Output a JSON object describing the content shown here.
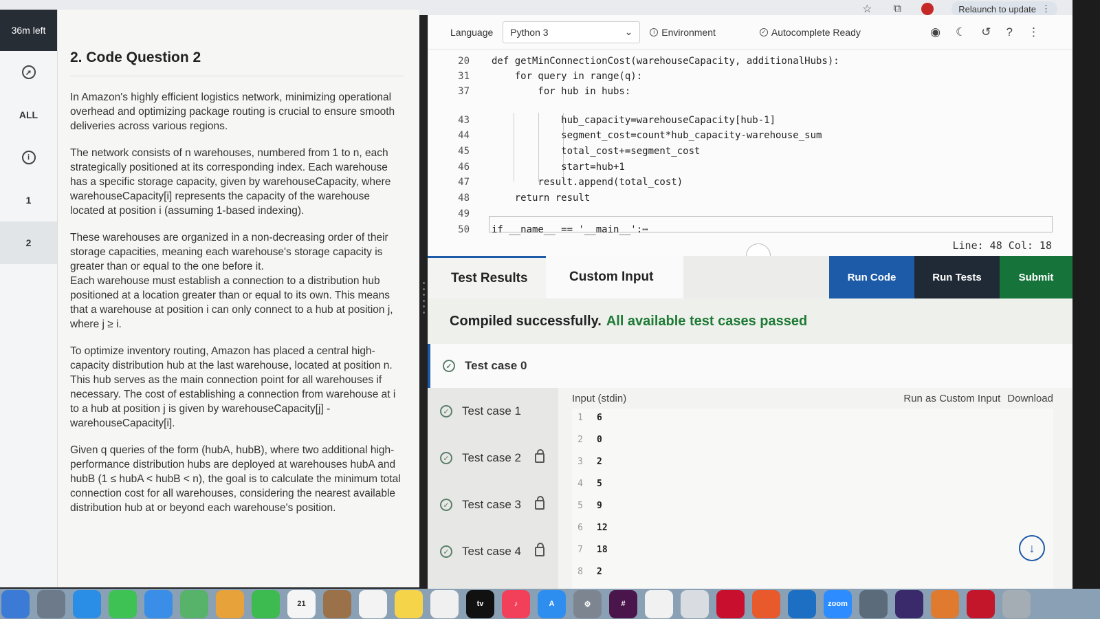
{
  "browser": {
    "relaunch_label": "Relaunch to update"
  },
  "left_nav": {
    "timer": "36m left",
    "items": [
      "ALL",
      "1",
      "2"
    ]
  },
  "problem": {
    "title": "2. Code Question 2",
    "p1": "In Amazon's highly efficient logistics network, minimizing operational overhead and optimizing package routing is crucial to ensure smooth deliveries across various regions.",
    "p2": "The network consists of n warehouses, numbered from 1 to n, each strategically positioned at its corresponding index. Each warehouse has a specific storage capacity, given by warehouseCapacity, where warehouseCapacity[i] represents the capacity of the warehouse located at position i (assuming 1-based indexing).",
    "p3": "These warehouses are organized in a non-decreasing order of their storage capacities, meaning each warehouse's storage capacity is greater than or equal to the one before it.",
    "p4": "Each warehouse must establish a connection to a distribution hub positioned at a location greater than or equal to its own. This means that a warehouse at position i can only connect to a hub at position j, where j ≥ i.",
    "p5": "To optimize inventory routing, Amazon has placed a central high-capacity distribution hub at the last warehouse, located at position n. This hub serves as the main connection point for all warehouses if necessary. The cost of establishing a connection from warehouse at i to a hub at position j is given by warehouseCapacity[j] - warehouseCapacity[i].",
    "p6": "Given q queries of the form (hubA, hubB), where two additional high-performance distribution hubs are deployed at warehouses hubA and hubB (1 ≤ hubA < hubB < n), the goal is to calculate the minimum total connection cost for all warehouses, considering the nearest available distribution hub at or beyond each warehouse's position."
  },
  "editor": {
    "language_label": "Language",
    "language_value": "Python 3",
    "environment_label": "Environment",
    "autocomplete_label": "Autocomplete Ready",
    "status": "Line: 48 Col: 18",
    "lines": [
      {
        "n": "20",
        "code": "def getMinConnectionCost(warehouseCapacity, additionalHubs):"
      },
      {
        "n": "31",
        "code": "    for query in range(q):"
      },
      {
        "n": "37",
        "code": "        for hub in hubs:"
      },
      {
        "n": "43",
        "code": "            hub_capacity=warehouseCapacity[hub-1]"
      },
      {
        "n": "44",
        "code": "            segment_cost=count*hub_capacity-warehouse_sum"
      },
      {
        "n": "45",
        "code": "            total_cost+=segment_cost"
      },
      {
        "n": "46",
        "code": "            start=hub+1"
      },
      {
        "n": "47",
        "code": "        result.append(total_cost)"
      },
      {
        "n": "48",
        "code": "    return result"
      },
      {
        "n": "49",
        "code": ""
      },
      {
        "n": "50",
        "code": "if __name__ == '__main__':⋯"
      }
    ]
  },
  "results": {
    "tab_results": "Test Results",
    "tab_custom": "Custom Input",
    "run_code": "Run Code",
    "run_tests": "Run Tests",
    "submit": "Submit",
    "compiled": "Compiled successfully.",
    "passed": "All available test cases passed",
    "cases": [
      "Test case 0",
      "Test case 1",
      "Test case 2",
      "Test case 3",
      "Test case 4"
    ],
    "stdin_label": "Input (stdin)",
    "run_custom": "Run as Custom Input",
    "download": "Download",
    "stdin_lines": [
      {
        "n": "1",
        "v": "6"
      },
      {
        "n": "2",
        "v": "0"
      },
      {
        "n": "3",
        "v": "2"
      },
      {
        "n": "4",
        "v": "5"
      },
      {
        "n": "5",
        "v": "9"
      },
      {
        "n": "6",
        "v": "12"
      },
      {
        "n": "7",
        "v": "18"
      },
      {
        "n": "8",
        "v": "2"
      }
    ]
  }
}
